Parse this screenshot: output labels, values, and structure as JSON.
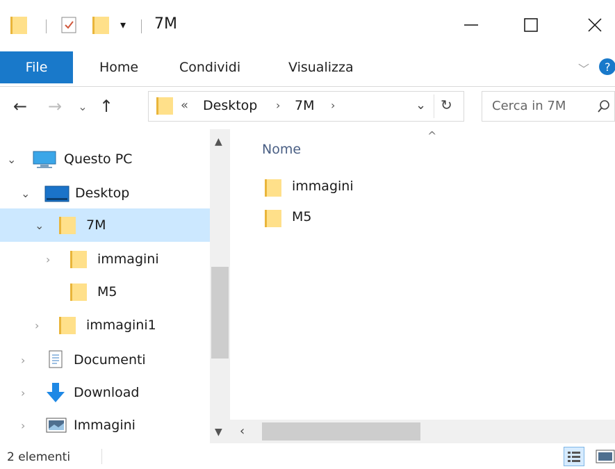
{
  "window": {
    "title": "7M",
    "controls": {
      "minimize": "minimize-icon",
      "maximize": "maximize-icon",
      "close": "close-icon"
    }
  },
  "ribbon": {
    "tabs": [
      "File",
      "Home",
      "Condividi",
      "Visualizza"
    ]
  },
  "address": {
    "overflow": "«",
    "crumbs": [
      "Desktop",
      "7M"
    ],
    "search_placeholder": "Cerca in 7M"
  },
  "nav_tree": [
    {
      "label": "Questo PC",
      "icon": "monitor-icon"
    },
    {
      "label": "Desktop",
      "icon": "desktop-icon"
    },
    {
      "label": "7M",
      "icon": "folder-icon",
      "selected": true
    },
    {
      "label": "immagini",
      "icon": "folder-icon"
    },
    {
      "label": "M5",
      "icon": "folder-icon"
    },
    {
      "label": "immagini1",
      "icon": "folder-icon"
    },
    {
      "label": "Documenti",
      "icon": "documents-icon"
    },
    {
      "label": "Download",
      "icon": "download-icon"
    },
    {
      "label": "Immagini",
      "icon": "pictures-icon"
    }
  ],
  "content": {
    "column_header": "Nome",
    "items": [
      {
        "name": "immagini",
        "icon": "folder-icon"
      },
      {
        "name": "M5",
        "icon": "folder-icon"
      }
    ]
  },
  "status": {
    "count": "2 elementi"
  },
  "colors": {
    "accent": "#1979ca",
    "selection": "#cce8ff",
    "folder": "#ffd96b"
  }
}
